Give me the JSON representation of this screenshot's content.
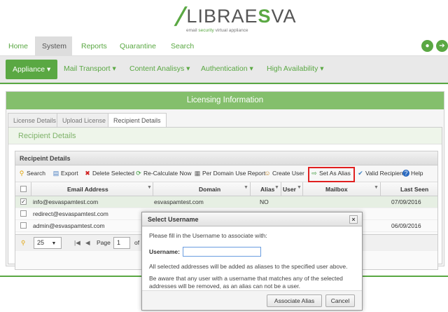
{
  "logo": {
    "prefix": "/",
    "word_a": "LIBRAE",
    "word_b": "S",
    "word_c": "VA",
    "tagline_a": "email",
    "tagline_b": "security",
    "tagline_c": "virtual appliance"
  },
  "topnav": {
    "tabs": [
      "Home",
      "System",
      "Reports",
      "Quarantine",
      "Search"
    ],
    "active": "System"
  },
  "subnav": {
    "items": [
      "Appliance ▾",
      "Mail Transport ▾",
      "Content Analisys ▾",
      "Authentication ▾",
      "High Availability ▾"
    ]
  },
  "panel": {
    "title": "Licensing Information",
    "tabs": [
      "License Details",
      "Upload License",
      "Recipient Details"
    ],
    "active_tab": "Recipient Details",
    "section_title": "Recipient Details"
  },
  "grid": {
    "title": "Recipeint Details",
    "toolbar": [
      "Search",
      "Export",
      "Delete Selected",
      "Re-Calculate Now",
      "Per Domain Use Report",
      "Create User",
      "Set As Alias",
      "Valid Recipient",
      "Help"
    ],
    "columns": [
      "Email Address",
      "Domain",
      "Alias",
      "User",
      "Mailbox",
      "Last Seen"
    ],
    "rows": [
      {
        "email": "info@esvaspamtest.com",
        "domain": "esvaspamtest.com",
        "alias": "NO",
        "last_seen": "07/09/2016",
        "checked": true
      },
      {
        "email": "redirect@esvaspamtest.com",
        "domain": "",
        "alias": "",
        "last_seen": "",
        "checked": false
      },
      {
        "email": "admin@esvaspamtest.com",
        "domain": "",
        "alias": "",
        "last_seen": "06/09/2016",
        "checked": false
      }
    ],
    "pager": {
      "page_size": "25",
      "page_label": "Page",
      "page": "1",
      "of": "of 1"
    }
  },
  "dialog": {
    "title": "Select Username",
    "intro": "Please fill in the Username to associate with:",
    "username_label": "Username:",
    "username_value": "",
    "note1": "All selected addresses will be added as aliases to the specified user above.",
    "note2": "Be aware that any user with a username that matches any of the selected addresses will be removed, as an alias can not be a user.",
    "associate_label": "Associate Alias",
    "cancel_label": "Cancel"
  },
  "colors": {
    "accent": "#5aa843",
    "header_green": "#84bf6c",
    "highlight": "#e02020"
  }
}
